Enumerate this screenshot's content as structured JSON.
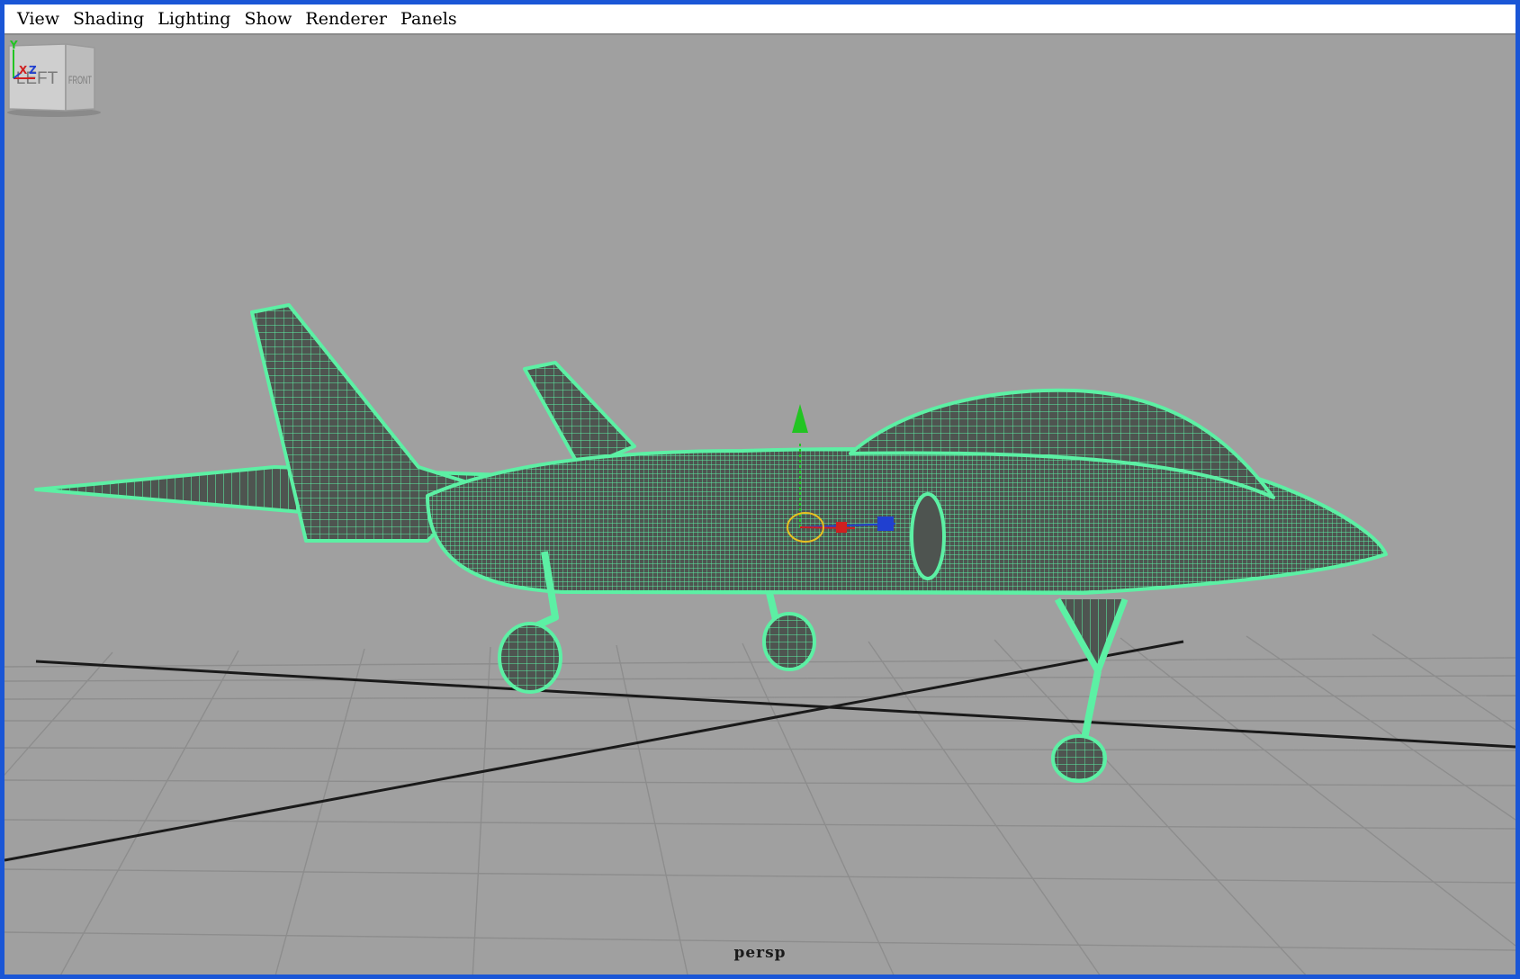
{
  "menu": {
    "items": [
      {
        "label": "View"
      },
      {
        "label": "Shading"
      },
      {
        "label": "Lighting"
      },
      {
        "label": "Show"
      },
      {
        "label": "Renderer"
      },
      {
        "label": "Panels"
      }
    ]
  },
  "viewport": {
    "camera_label": "persp",
    "background_color": "#a0a0a0",
    "grid_color": "#8d8d8d",
    "wireframe_color": "#5cf0a4",
    "mesh_fill_color": "#4e5450"
  },
  "viewcube": {
    "left_face": "LEFT",
    "front_face": "FRONT"
  },
  "axis_tripod": {
    "y_label": "Y",
    "x_label": "X",
    "z_label": "Z"
  },
  "manipulator": {
    "y_color": "#22c422",
    "x_color": "#d02020",
    "z_color": "#2040d0"
  }
}
